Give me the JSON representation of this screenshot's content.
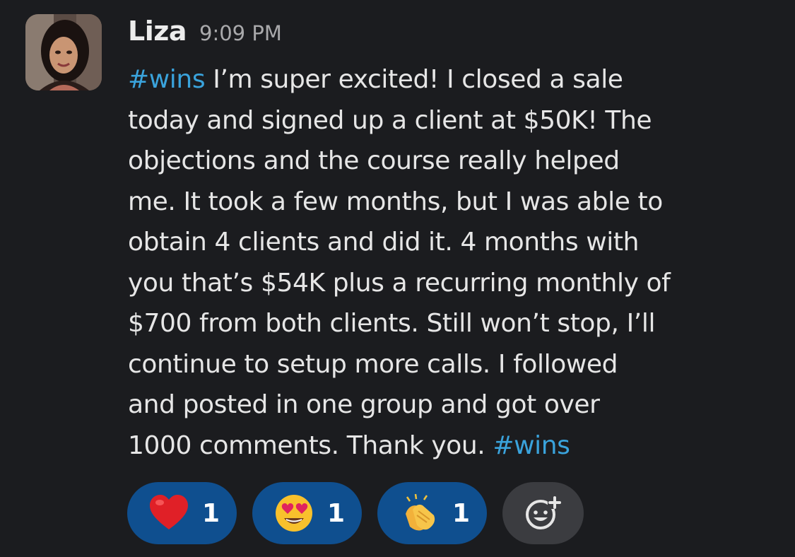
{
  "message": {
    "author": "Liza",
    "time": "9:09 PM",
    "lines": [
      [
        {
          "t": "#wins",
          "tag": true
        },
        {
          "t": " I’m super excited! I closed a sale"
        }
      ],
      [
        {
          "t": "today and signed up a client at $50K! The"
        }
      ],
      [
        {
          "t": "objections and the course really helped"
        }
      ],
      [
        {
          "t": "me. It took a few months, but I was able to"
        }
      ],
      [
        {
          "t": "obtain 4 clients and did it.  4 months with"
        }
      ],
      [
        {
          "t": "you that’s $54K plus a recurring monthly of"
        }
      ],
      [
        {
          "t": "$700 from both clients. Still won’t stop, I’ll"
        }
      ],
      [
        {
          "t": "continue to setup more calls. I followed"
        }
      ],
      [
        {
          "t": "and posted in one group and got over"
        }
      ],
      [
        {
          "t": "1000 comments. Thank you.  "
        },
        {
          "t": "#wins",
          "tag": true
        }
      ]
    ]
  },
  "reactions": [
    {
      "emoji": "heart-emoji",
      "count": "1"
    },
    {
      "emoji": "heart-eyes-emoji",
      "count": "1"
    },
    {
      "emoji": "clapping-hands-emoji",
      "count": "1"
    }
  ],
  "add_reaction": {
    "icon": "add-reaction-icon"
  },
  "colors": {
    "background": "#1b1c1f",
    "hashtag": "#3aa3dc",
    "reaction_bg": "#0f4f8f",
    "add_reaction_bg": "#3b3c40"
  }
}
